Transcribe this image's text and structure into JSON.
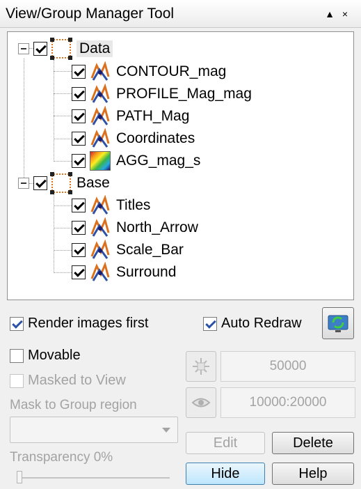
{
  "window": {
    "title": "View/Group Manager Tool",
    "pin_glyph": "▲",
    "close_glyph": "×"
  },
  "tree": {
    "groups": [
      {
        "label": "Data",
        "checked": true,
        "selected": true,
        "items": [
          {
            "label": "CONTOUR_mag",
            "checked": true,
            "icon": "map-layer-icon"
          },
          {
            "label": "PROFILE_Mag_mag",
            "checked": true,
            "icon": "map-layer-icon"
          },
          {
            "label": "PATH_Mag",
            "checked": true,
            "icon": "map-layer-icon"
          },
          {
            "label": "Coordinates",
            "checked": true,
            "icon": "map-layer-icon"
          },
          {
            "label": "AGG_mag_s",
            "checked": true,
            "icon": "grid-image-icon"
          }
        ]
      },
      {
        "label": "Base",
        "checked": true,
        "selected": false,
        "items": [
          {
            "label": "Titles",
            "checked": true,
            "icon": "map-layer-icon"
          },
          {
            "label": "North_Arrow",
            "checked": true,
            "icon": "map-layer-icon"
          },
          {
            "label": "Scale_Bar",
            "checked": true,
            "icon": "map-layer-icon"
          },
          {
            "label": "Surround",
            "checked": true,
            "icon": "map-layer-icon"
          }
        ]
      }
    ]
  },
  "options": {
    "render_images_first": {
      "label": "Render images first",
      "checked": true
    },
    "auto_redraw": {
      "label": "Auto Redraw",
      "checked": true
    },
    "movable": {
      "label": "Movable",
      "checked": false
    },
    "masked_to_view": {
      "label": "Masked to View",
      "checked": false
    }
  },
  "mask": {
    "label": "Mask to Group region",
    "selected": ""
  },
  "transparency": {
    "label": "Transparency 0%",
    "value_percent": 0
  },
  "scale": {
    "value": "50000",
    "range": "10000:20000"
  },
  "buttons": {
    "edit": "Edit",
    "delete": "Delete",
    "hide": "Hide",
    "help": "Help"
  },
  "colors": {
    "group_frame": "#d9711f",
    "check_mark": "#2b52a7",
    "disabled_text": "#a3a3a3"
  }
}
